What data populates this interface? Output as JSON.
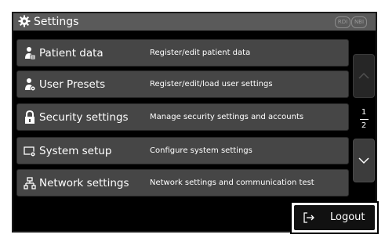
{
  "header": {
    "title": "Settings",
    "indicators": [
      "RDI",
      "NBI"
    ]
  },
  "menu": {
    "items": [
      {
        "label": "Patient data",
        "description": "Register/edit patient data",
        "icon": "patient-icon"
      },
      {
        "label": "User Presets",
        "description": "Register/edit/load user settings",
        "icon": "user-presets-icon"
      },
      {
        "label": "Security settings",
        "description": "Manage security settings and accounts",
        "icon": "lock-icon"
      },
      {
        "label": "System setup",
        "description": "Configure system settings",
        "icon": "system-setup-icon"
      },
      {
        "label": "Network settings",
        "description": "Network settings and communication test",
        "icon": "network-icon"
      }
    ]
  },
  "pagination": {
    "current": "1",
    "total": "2"
  },
  "logout": {
    "label": "Logout",
    "icon": "logout-icon"
  },
  "colors": {
    "screen_bg": "#000000",
    "titlebar_bg": "#5a5a5a",
    "menu_item_bg": "#464646",
    "text": "#ffffff"
  }
}
